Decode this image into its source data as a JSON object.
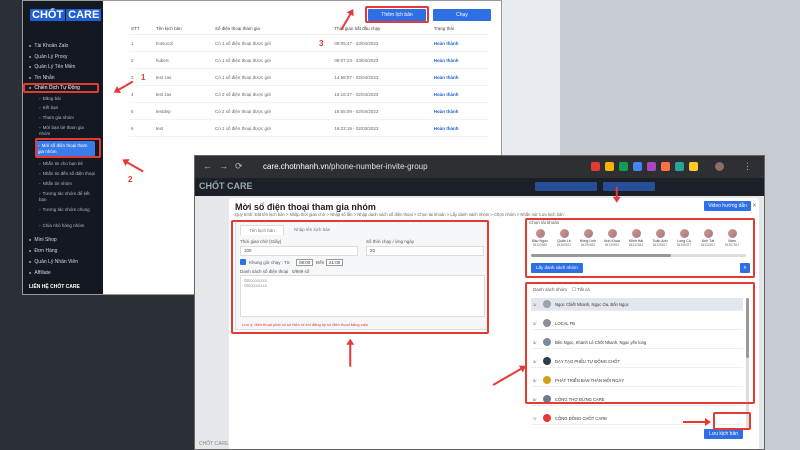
{
  "colors": {
    "accent": "#2f6fe4",
    "annotation": "#e53935",
    "sidebar_bg": "#141821"
  },
  "shot1": {
    "logo_left": "CHỐT",
    "logo_right": "CARE",
    "nav": [
      "Tài Khoản Zalo",
      "Quản Lý Proxy",
      "Quản Lý Tên Miền",
      "Tin Nhắn"
    ],
    "nav_active_parent": "Chiến Dịch Tự Động",
    "nav_sub": [
      "Đăng bài",
      "Kết bạn",
      "Tham gia nhóm",
      "Mời bạn bè tham gia nhóm",
      "Mời số điện thoại tham gia nhóm",
      "Nhắn tin cho bạn bè",
      "Nhắn tin đến số điện thoại",
      "Nhắn tin nhóm",
      "Tương tác nhóm để kết bạn",
      "Tương tác nhóm chung",
      "Chia nhỏ hàng nhóm"
    ],
    "nav_bottom": [
      "Mini Shop",
      "Đơn Hàng",
      "Quản Lý Nhân Viên",
      "Affiliate"
    ],
    "footer": "LIÊN HỆ CHỐT CARE",
    "buttons": {
      "create": "Thêm lịch bản",
      "refresh": "Chạy"
    },
    "columns": [
      "STT",
      "Tên kịch bản",
      "Số điện thoại tham gia",
      "Thời gian bắt đầu chạy",
      "Trạng thái"
    ],
    "rows": [
      [
        "1",
        "hotsocol",
        "Có 1 số điện thoại được gửi",
        "09:05:47 - 23/04/2023",
        "Hoàn thành"
      ],
      [
        "2",
        "hubert",
        "Có 1 số điện thoại được gửi",
        "09:07:23 - 23/04/2023",
        "Hoàn thành"
      ],
      [
        "3",
        "test zas",
        "Có 1 số điện thoại được gửi",
        "14:58:07 - 02/04/2023",
        "Hoàn thành"
      ],
      [
        "4",
        "test zas",
        "Có 2 số điện thoại được gửi",
        "16:18:37 - 02/04/2023",
        "Hoàn thành"
      ],
      [
        "5",
        "testdep",
        "Có 2 số điện thoại được gửi",
        "16:55:09 - 02/04/2023",
        "Hoàn thành"
      ],
      [
        "6",
        "test",
        "Có 1 số điện thoại được gửi",
        "16:23:19 - 02/03/2023",
        "Hoàn thành"
      ]
    ],
    "annotation_numbers": [
      "1",
      "2",
      "3"
    ]
  },
  "shot2": {
    "url_host": "care.chotnhanh.vn",
    "url_path": "/phone-number-invite-group",
    "logo": "CHỐT CARE",
    "modal": {
      "title": "Mời số điện thoại tham gia nhóm",
      "hint": "Quy trình: Đặt tên kịch bản > Nhập thời gian chờ > Nhập số lần > Nhập danh sách số điện thoại > Chọn tài khoản > Lấy danh sách nhóm > Chọn nhóm > Nhấn nút 'Lưu kịch bản'",
      "guide_btn": "Video hướng dẫn",
      "tabs": [
        "Tên kịch bản",
        "Nhập tên kịch bản"
      ],
      "wait_label": "Thời gian chờ (Giây)",
      "wait_value": "100",
      "count_label": "Số thời chạy / ứng ngày",
      "count_value": "20",
      "schedule_label": "Khung giờ chạy : Từ",
      "from_time": "08:00",
      "to_label": "Đến",
      "to_time": "21:00",
      "phone_list_label": "Danh sách số điện thoại",
      "phone_count": "0/999 số",
      "placeholder_1": "09xxxxxxxx",
      "placeholder_2": "09xxxxxxxx",
      "warning": "Lưu ý: điện thoại phải có số hiện ra khi đăng ký số điện thoại bằng zalo",
      "account_label": "Chọn tài khoản",
      "accounts": [
        {
          "name": "Bảo Ngọc",
          "phone": "84329585"
        },
        {
          "name": "Quân Lê",
          "phone": "84365532"
        },
        {
          "name": "Hồng Linh",
          "phone": "84395555"
        },
        {
          "name": "Anh Khoa",
          "phone": "84335994"
        },
        {
          "name": "Minh Hải",
          "phone": "84832584"
        },
        {
          "name": "Tuấn Anh",
          "phone": "84328837"
        },
        {
          "name": "Long Cù",
          "phone": "84398257"
        },
        {
          "name": "Anh Tài",
          "phone": "84332897"
        },
        {
          "name": "Nam",
          "phone": "84357551"
        }
      ],
      "get_groups_btn": "Lấy danh sách nhóm",
      "group_header": [
        "Danh sách nhóm",
        "Tất cả"
      ],
      "groups": [
        "Ngọc Chiết Nhanh, Ngọc Oa, Bốn Ngọc",
        "LOCAL FB",
        "Bên Ngọc, Khánh Lê Chốt Nhanh, Ngọc yến long",
        "DẠY TẠO PHỄU TỰ ĐỘNG CHỐT",
        "PHÁT TRIỂN BẢN THÂN MỖI NGÀY",
        "CỘNG THỢ ĐỨNG CARE",
        "CỘNG ĐỒNG CHỐT CARE"
      ],
      "save_btn": "Lưu kịch bản"
    },
    "footer": "CHỐT CARE"
  }
}
